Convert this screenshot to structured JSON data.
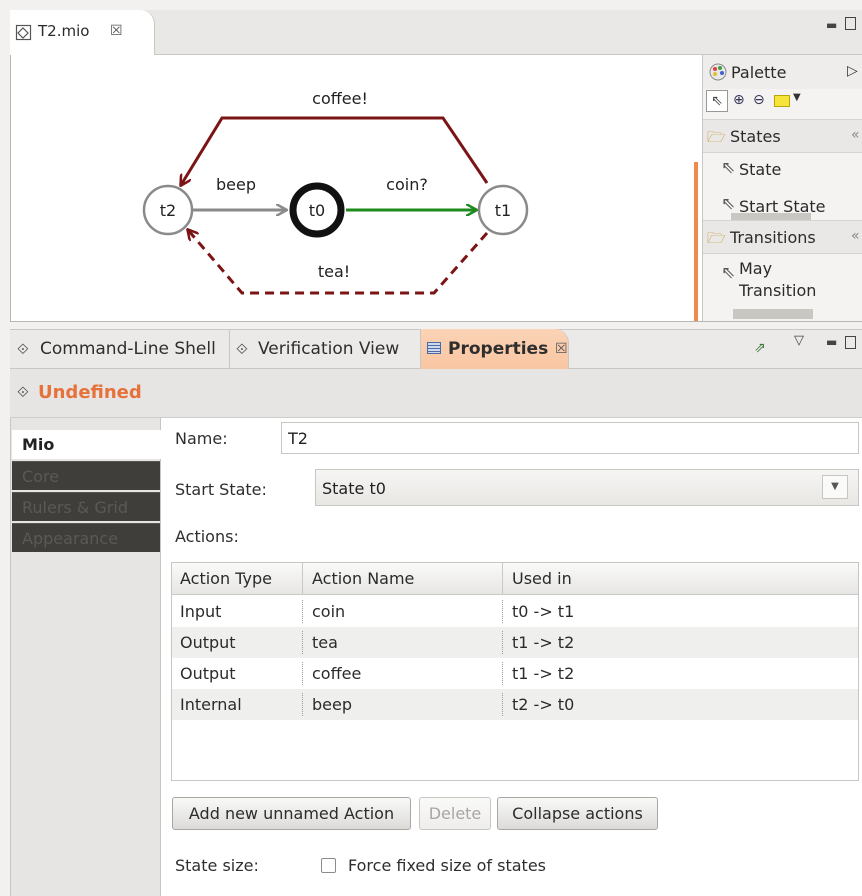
{
  "editor": {
    "tab_label": "T2.mio",
    "close_glyph": "☒",
    "minimize_glyph": "▭",
    "maximize_glyph": "🗖"
  },
  "diagram": {
    "states": [
      {
        "id": "t2",
        "label": "t2",
        "start": false
      },
      {
        "id": "t0",
        "label": "t0",
        "start": true
      },
      {
        "id": "t1",
        "label": "t1",
        "start": false
      }
    ],
    "transitions": [
      {
        "label": "beep",
        "from": "t2",
        "to": "t0",
        "kind": "internal",
        "color": "#8a8a8a"
      },
      {
        "label": "coin?",
        "from": "t0",
        "to": "t1",
        "kind": "input",
        "color": "#1e8a1e"
      },
      {
        "label": "coffee!",
        "from": "t1",
        "to": "t2",
        "kind": "output-must",
        "color": "#7b1414"
      },
      {
        "label": "tea!",
        "from": "t1",
        "to": "t2",
        "kind": "output-may",
        "color": "#7b1414"
      }
    ]
  },
  "palette": {
    "title": "Palette",
    "sections": [
      {
        "title": "States",
        "items": [
          "State",
          "Start State"
        ]
      },
      {
        "title": "Transitions",
        "items": [
          "May Transition"
        ]
      }
    ],
    "may_line1": "May",
    "may_line2": "Transition",
    "collapse_glyph": "«"
  },
  "views": {
    "tabs": [
      {
        "label": "Command-Line Shell",
        "active": false
      },
      {
        "label": "Verification View",
        "active": false
      },
      {
        "label": "Properties",
        "active": true
      }
    ],
    "close_glyph": "☒",
    "menu_glyph": "▽"
  },
  "properties": {
    "header_title": "Undefined",
    "side_tabs": [
      "Mio",
      "Core",
      "Rulers & Grid",
      "Appearance"
    ],
    "name_label": "Name:",
    "name_value": "T2",
    "start_state_label": "Start State:",
    "start_state_value": "State t0",
    "actions_label": "Actions:",
    "table": {
      "columns": [
        "Action Type",
        "Action Name",
        "Used in"
      ],
      "rows": [
        [
          "Input",
          "coin",
          "t0 -> t1"
        ],
        [
          "Output",
          "tea",
          "t1 -> t2"
        ],
        [
          "Output",
          "coffee",
          "t1 -> t2"
        ],
        [
          "Internal",
          "beep",
          "t2 -> t0"
        ]
      ]
    },
    "buttons": {
      "add": "Add new unnamed Action",
      "delete": "Delete",
      "collapse": "Collapse actions"
    },
    "state_size_label": "State size:",
    "force_fixed_label": "Force fixed size of states",
    "force_fixed_checked": false
  }
}
